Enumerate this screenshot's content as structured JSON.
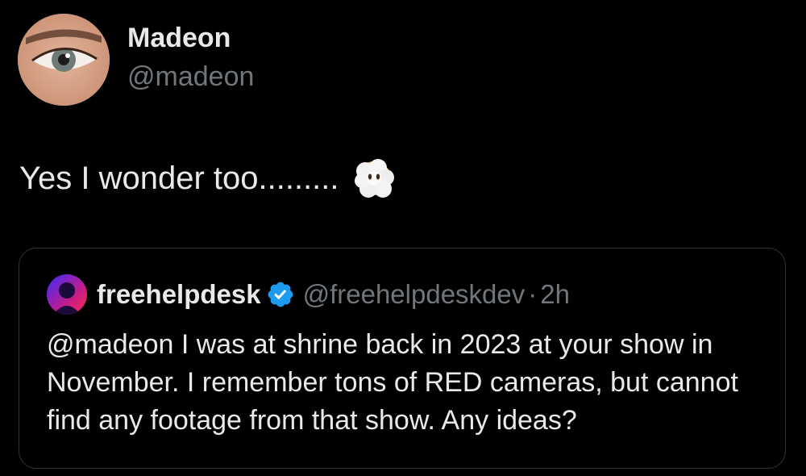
{
  "author": {
    "name": "Madeon",
    "handle": "@madeon",
    "avatar_icon": "profile-photo-eye"
  },
  "tweet": {
    "text": "Yes I wonder too.........",
    "emoji_icon": "face-in-clouds-emoji"
  },
  "quote": {
    "name": "freehelpdesk",
    "verified_icon": "verified-badge-icon",
    "handle": "@freehelpdeskdev",
    "separator": "·",
    "time": "2h",
    "text": "@madeon I was at shrine back in 2023 at your show in November. I remember tons of RED cameras, but cannot find any footage from that show. Any ideas?"
  },
  "colors": {
    "background": "#000000",
    "primary_text": "#e7e9ea",
    "secondary_text": "#71767b",
    "border": "#2f3336",
    "verified": "#1d9bf0"
  }
}
